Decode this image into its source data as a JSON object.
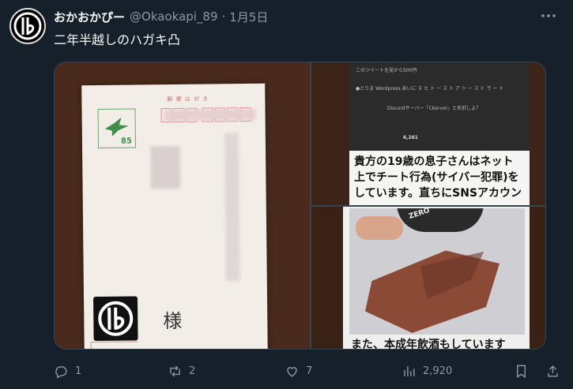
{
  "tweet": {
    "display_name": "おかおかぴー",
    "handle": "@Okaokapi_89",
    "separator": "·",
    "time": "1月5日",
    "text": "二年半越しのハガキ凸"
  },
  "postcard": {
    "label": "郵 便 は が き",
    "stamp_value": "85",
    "sama": "様"
  },
  "notice_image": {
    "screen_lines": [
      "このツイートを見から500円",
      "●とりま Wordpress あいに ヌ ヒ ト ー ス ト ア ツ ー ス ト ラ ー ト",
      "Discordサーバー「CKerver」と名前しよ？"
    ],
    "screen_stat": "6,261",
    "lines": [
      "貴方の19歳の息子さんはネット",
      "上でチート行為(サイバー犯罪)を",
      "しています。直ちにSNSアカウン"
    ]
  },
  "photo_image": {
    "can_label": "ZERO",
    "caption": "また、本成年飲酒もしています"
  },
  "actions": {
    "replies": "1",
    "retweets": "2",
    "likes": "7",
    "views": "2,920"
  }
}
